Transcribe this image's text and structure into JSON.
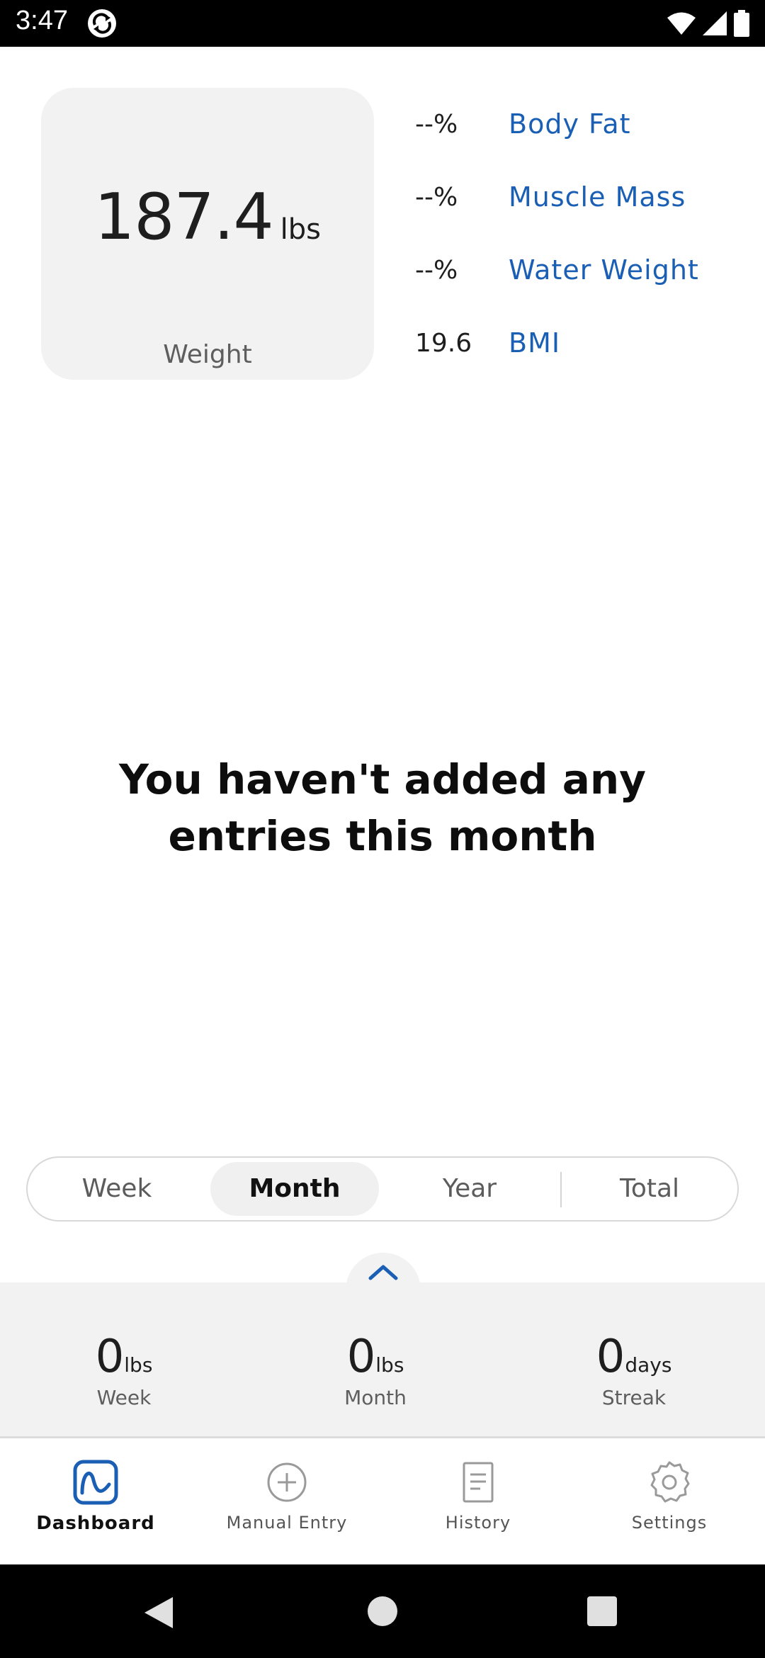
{
  "status_bar": {
    "time": "3:47",
    "icons": [
      "sync-icon",
      "wifi-icon",
      "signal-icon",
      "battery-icon"
    ]
  },
  "weight_card": {
    "value": "187.4",
    "unit": "lbs",
    "label": "Weight"
  },
  "metrics": [
    {
      "value": "--%",
      "label": "Body Fat"
    },
    {
      "value": "--%",
      "label": "Muscle Mass"
    },
    {
      "value": "--%",
      "label": "Water Weight"
    },
    {
      "value": "19.6",
      "label": "BMI"
    }
  ],
  "empty_message": "You haven't added any entries this month",
  "period_tabs": {
    "items": [
      "Week",
      "Month",
      "Year",
      "Total"
    ],
    "selected": "Month"
  },
  "summary": {
    "expand_icon": "chevron-up-icon",
    "stats": [
      {
        "value": "0",
        "unit": "lbs",
        "label": "Week"
      },
      {
        "value": "0",
        "unit": "lbs",
        "label": "Month"
      },
      {
        "value": "0",
        "unit": "days",
        "label": "Streak"
      }
    ]
  },
  "bottom_nav": {
    "items": [
      {
        "label": "Dashboard",
        "icon": "chart-icon",
        "active": true
      },
      {
        "label": "Manual Entry",
        "icon": "plus-circle-icon",
        "active": false
      },
      {
        "label": "History",
        "icon": "document-icon",
        "active": false
      },
      {
        "label": "Settings",
        "icon": "gear-icon",
        "active": false
      }
    ]
  },
  "colors": {
    "accent": "#1a5fb4",
    "card_background": "#f2f2f2",
    "text": "#1e1e1e"
  }
}
